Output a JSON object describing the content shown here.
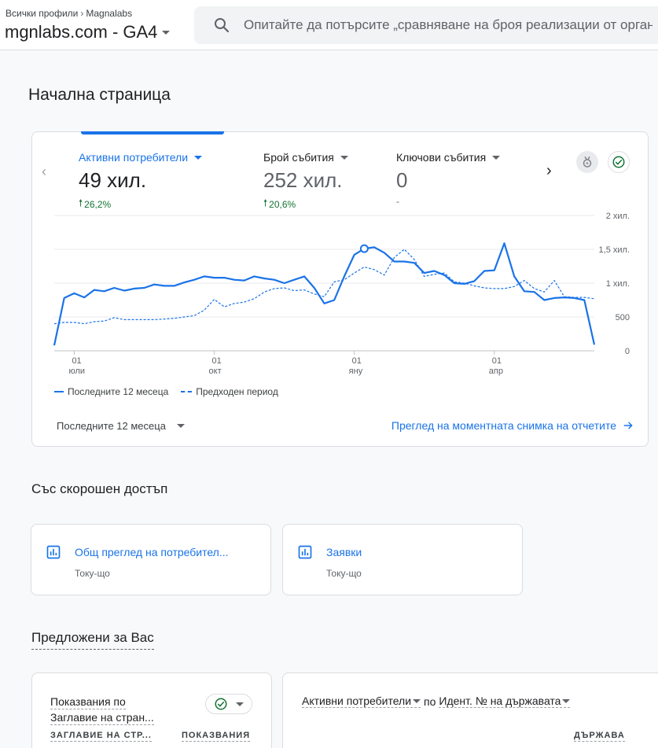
{
  "header": {
    "breadcrumb": [
      "Всички профили",
      "Magnalabs"
    ],
    "property": "mgnlabs.com - GA4",
    "search_placeholder": "Опитайте да потърсите „сравняване на броя реализации от органичните търсения“"
  },
  "page_title": "Начална страница",
  "overview": {
    "metrics": [
      {
        "label": "Активни потребители",
        "value": "49 хил.",
        "change": "26,2%",
        "active": true
      },
      {
        "label": "Брой събития",
        "value": "252 хил.",
        "change": "20,6%",
        "active": false
      },
      {
        "label": "Ключови събития",
        "value": "0",
        "change": "-",
        "active": false
      }
    ],
    "legend": {
      "current": "Последните 12 месеца",
      "previous": "Предходен период"
    },
    "range_select": "Последните 12 месеца",
    "snapshot_link": "Преглед на моментната снимка на отчетите",
    "icons": [
      "chevron-left-icon",
      "chevron-right-icon",
      "insights-icon",
      "check-circle-icon",
      "arrow-right-icon"
    ]
  },
  "chart_data": {
    "type": "line",
    "x_ticks": [
      {
        "day": "01",
        "month": "юли"
      },
      {
        "day": "01",
        "month": "окт"
      },
      {
        "day": "01",
        "month": "яну"
      },
      {
        "day": "01",
        "month": "апр"
      }
    ],
    "y_ticks": [
      "2 хил.",
      "1,5 хил.",
      "1 хил.",
      "500",
      "0"
    ],
    "ylim": [
      0,
      2000
    ],
    "series": [
      {
        "name": "Последните 12 месеца",
        "style": "solid",
        "values": [
          80,
          780,
          850,
          790,
          900,
          880,
          930,
          890,
          920,
          930,
          980,
          960,
          960,
          1010,
          1050,
          1100,
          1080,
          1080,
          1050,
          1040,
          1100,
          1070,
          1050,
          1000,
          1050,
          1100,
          930,
          700,
          750,
          1100,
          1420,
          1510,
          1530,
          1450,
          1320,
          1320,
          1300,
          1150,
          1180,
          1120,
          1000,
          990,
          1030,
          1180,
          1190,
          1590,
          1100,
          880,
          870,
          750,
          780,
          790,
          780,
          750,
          90
        ]
      },
      {
        "name": "Предходен период",
        "style": "dashed",
        "values": [
          400,
          420,
          420,
          400,
          430,
          440,
          490,
          460,
          460,
          460,
          460,
          470,
          480,
          500,
          520,
          600,
          760,
          650,
          700,
          720,
          770,
          870,
          920,
          930,
          890,
          900,
          840,
          800,
          1020,
          1050,
          1150,
          1240,
          1200,
          1120,
          1380,
          1500,
          1350,
          1100,
          1130,
          1150,
          1020,
          1000,
          960,
          930,
          920,
          920,
          950,
          1040,
          920,
          870,
          1040,
          800,
          790,
          790,
          770
        ]
      }
    ],
    "highlight_index": 31
  },
  "recent": {
    "title": "Със скорошен достъп",
    "items": [
      {
        "title": "Общ преглед на потребител...",
        "time": "Току-що"
      },
      {
        "title": "Заявки",
        "time": "Току-що"
      }
    ]
  },
  "suggested": {
    "title": "Предложени за Вас",
    "card1": {
      "title_line1": "Показвания по",
      "title_line2": "Заглавие на стран...",
      "col1": "ЗАГЛАВИЕ НА СТР...",
      "col2": "ПОКАЗВАНИЯ"
    },
    "card2": {
      "metric": "Активни потребители",
      "by": "по",
      "dimension": "Идент. № на държавата",
      "col": "ДЪРЖАВА"
    }
  }
}
